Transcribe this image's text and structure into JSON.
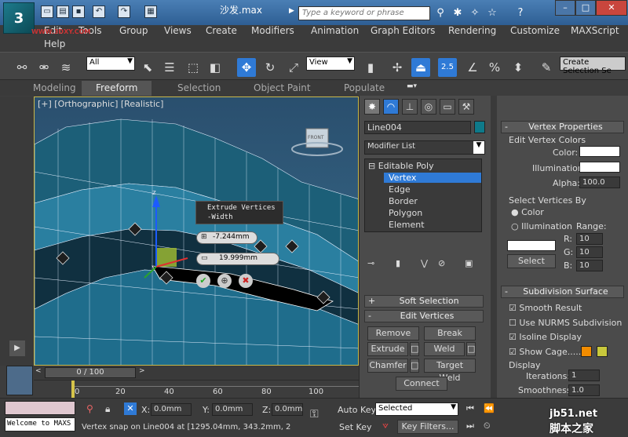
{
  "window": {
    "title": "沙发.max",
    "search_placeholder": "Type a keyword or phrase"
  },
  "logo": {
    "watermark": "WWW.3DXY.COM"
  },
  "menu": [
    "Edit",
    "Tools",
    "Group",
    "Views",
    "Create",
    "Modifiers",
    "Animation",
    "Graph Editors",
    "Rendering",
    "Customize",
    "MAXScript",
    "Help"
  ],
  "toolbar": {
    "filter": "All",
    "coord": "View",
    "snap": "2.5",
    "selection_set": "Create Selection Se"
  },
  "ribbon": [
    "Modeling",
    "Freeform",
    "Selection",
    "Object Paint",
    "Populate"
  ],
  "viewport": {
    "label": "[+] [Orthographic] [Realistic]",
    "tooltip_line1": "Extrude Vertices",
    "tooltip_line2": "-Width",
    "height_value": "-7.244mm",
    "width_value": "19.999mm",
    "axis_z": "z",
    "viewcube": "FRONT"
  },
  "command_panel": {
    "object_name": "Line004",
    "object_color": "#0e7a8a",
    "modifier_list": "Modifier List",
    "stack": [
      "Editable Poly",
      "Vertex",
      "Edge",
      "Border",
      "Polygon",
      "Element"
    ],
    "soft_selection": "Soft Selection",
    "edit_vertices": "Edit Vertices",
    "buttons": {
      "remove": "Remove",
      "break": "Break",
      "extrude": "Extrude",
      "weld": "Weld",
      "chamfer": "Chamfer",
      "target_weld": "Target Weld",
      "connect": "Connect"
    }
  },
  "vertex_props": {
    "title": "Vertex Properties",
    "edit_colors": "Edit Vertex Colors",
    "color": "Color:",
    "illumination": "Illumination:",
    "alpha_label": "Alpha:",
    "alpha": "100.0",
    "select_by": "Select Vertices By",
    "opt_color": "Color",
    "opt_illum": "Illumination",
    "range": "Range:",
    "r": "R:",
    "g": "G:",
    "b": "B:",
    "r_val": "10",
    "g_val": "10",
    "b_val": "10",
    "select": "Select"
  },
  "subdivision": {
    "title": "Subdivision Surface",
    "smooth_result": "Smooth Result",
    "nurms": "Use NURMS Subdivision",
    "isoline": "Isoline Display",
    "show_cage": "Show Cage......",
    "display": "Display",
    "iterations_label": "Iterations:",
    "iterations": "1",
    "smoothness_label": "Smoothness:",
    "smoothness": "1.0"
  },
  "timeline": {
    "frame": "0 / 100",
    "ticks": [
      "0",
      "20",
      "40",
      "60",
      "80",
      "100"
    ]
  },
  "status": {
    "welcome": "Welcome to MAXS",
    "x_label": "X:",
    "x": "0.0mm",
    "y_label": "Y:",
    "y": "0.0mm",
    "z_label": "Z:",
    "z": "0.0mm",
    "auto_key": "Auto Key",
    "selected": "Selected",
    "set_key": "Set Key",
    "key_filters": "Key Filters...",
    "prompt": "Vertex snap on Line004 at [1295.04mm, 343.2mm, 2"
  },
  "watermark": {
    "site": "jb51.net",
    "name": "脚本之家"
  }
}
